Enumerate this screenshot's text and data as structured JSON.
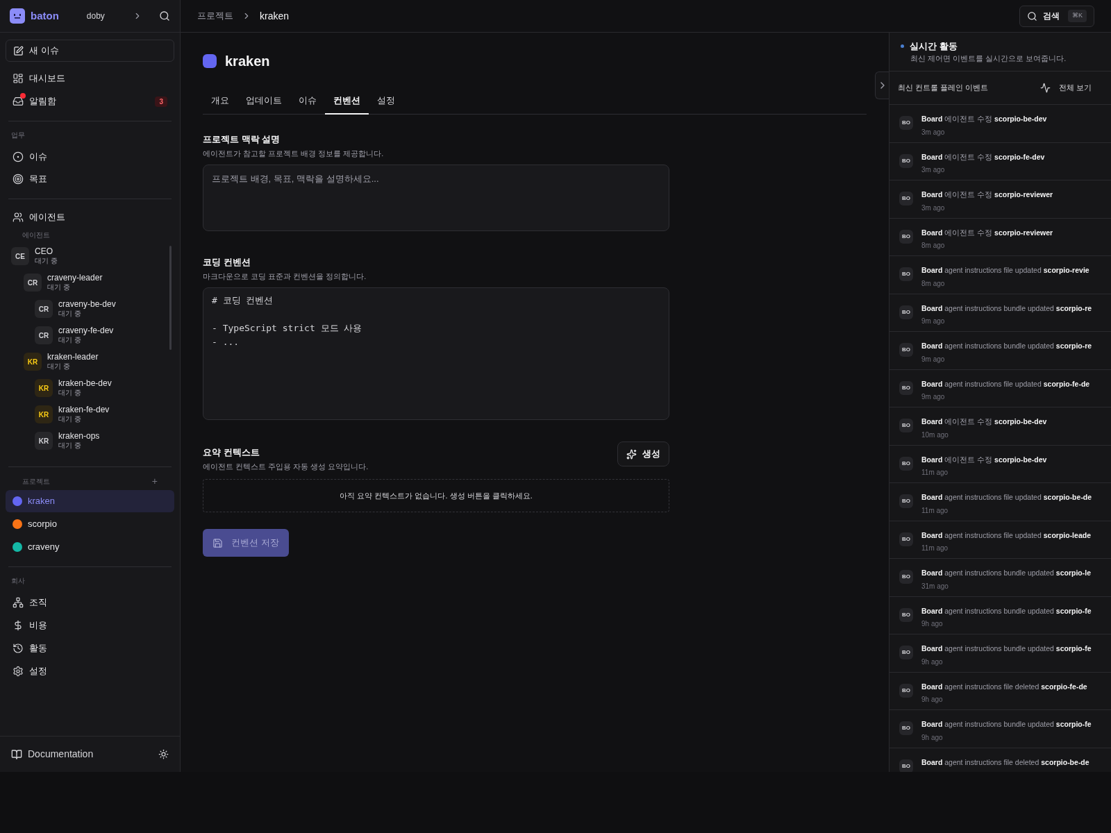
{
  "sidebar": {
    "brand": "baton",
    "workspace": "doby",
    "new_issue": "새 이슈",
    "top_items": [
      {
        "label": "대시보드"
      },
      {
        "label": "알림함",
        "badge": "3",
        "unread": true
      }
    ],
    "sections": [
      {
        "title": "업무",
        "items": [
          {
            "label": "이슈"
          },
          {
            "label": "목표"
          }
        ]
      }
    ],
    "agents": {
      "label": "에이전트",
      "heading": "에이전트",
      "tree": [
        {
          "initials": "CE",
          "name": "CEO",
          "status": "대기 중",
          "color": "#d4d4d8",
          "children": [
            {
              "initials": "CR",
              "name": "craveny-leader",
              "status": "대기 중",
              "color": "#d4d4d8",
              "children": [
                {
                  "initials": "CR",
                  "name": "craveny-be-dev",
                  "status": "대기 중",
                  "color": "#d4d4d8"
                },
                {
                  "initials": "CR",
                  "name": "craveny-fe-dev",
                  "status": "대기 중",
                  "color": "#d4d4d8"
                }
              ]
            },
            {
              "initials": "KR",
              "name": "kraken-leader",
              "status": "대기 중",
              "color": "#facc15",
              "children": [
                {
                  "initials": "KR",
                  "name": "kraken-be-dev",
                  "status": "대기 중",
                  "color": "#facc15"
                },
                {
                  "initials": "KR",
                  "name": "kraken-fe-dev",
                  "status": "대기 중",
                  "color": "#facc15"
                },
                {
                  "initials": "KR",
                  "name": "kraken-ops",
                  "status": "대기 중",
                  "color": "#d4d4d8"
                }
              ]
            }
          ]
        }
      ]
    },
    "projects": {
      "title": "프로젝트",
      "add": "+",
      "items": [
        {
          "name": "kraken",
          "color": "#6366f1",
          "selected": true
        },
        {
          "name": "scorpio",
          "color": "#f97316",
          "selected": false
        },
        {
          "name": "craveny",
          "color": "#14b8a6",
          "selected": false
        }
      ]
    },
    "company": {
      "title": "회사",
      "items": [
        {
          "label": "조직"
        },
        {
          "label": "비용"
        },
        {
          "label": "활동"
        },
        {
          "label": "설정"
        }
      ]
    },
    "docs": "Documentation"
  },
  "breadcrumb": [
    "프로젝트",
    "kraken"
  ],
  "search": {
    "label": "검색",
    "shortcut": "⌘K"
  },
  "project": {
    "name": "kraken",
    "color": "#6366f1"
  },
  "tabs": [
    {
      "label": "개요",
      "selected": false
    },
    {
      "label": "업데이트",
      "selected": false
    },
    {
      "label": "이슈",
      "selected": false
    },
    {
      "label": "컨벤션",
      "selected": true
    },
    {
      "label": "설정",
      "selected": false
    }
  ],
  "context": {
    "title": "프로젝트 맥락 설명",
    "description": "에이전트가 참고할 프로젝트 배경 정보를 제공합니다.",
    "placeholder": "프로젝트 배경, 목표, 맥락을 설명하세요..."
  },
  "conventions": {
    "title": "코딩 컨벤션",
    "description": "마크다운으로 코딩 표준과 컨벤션을 정의합니다.",
    "value": "# 코딩 컨벤션\n\n- TypeScript strict 모드 사용\n- ..."
  },
  "summary": {
    "title": "요약 컨텍스트",
    "description": "에이전트 컨텍스트 주입용 자동 생성 요약입니다.",
    "generate": "생성",
    "empty": "아직 요약 컨텍스트가 없습니다. 생성 버튼을 클릭하세요."
  },
  "save": {
    "label": "컨벤션 저장",
    "disabled": true
  },
  "activity": {
    "title": "실시간 활동",
    "subtitle": "최신 제어면 이벤트를 실시간으로 보여줍니다.",
    "list_title": "최신 컨트롤 플레인 이벤트",
    "view_all": "전체 보기",
    "events": [
      {
        "avatar": "BO",
        "actor": "Board",
        "action": "에이전트 수정",
        "target": "scorpio-be-dev",
        "time": "3m ago"
      },
      {
        "avatar": "BO",
        "actor": "Board",
        "action": "에이전트 수정",
        "target": "scorpio-fe-dev",
        "time": "3m ago"
      },
      {
        "avatar": "BO",
        "actor": "Board",
        "action": "에이전트 수정",
        "target": "scorpio-reviewer",
        "time": "3m ago"
      },
      {
        "avatar": "BO",
        "actor": "Board",
        "action": "에이전트 수정",
        "target": "scorpio-reviewer",
        "time": "8m ago"
      },
      {
        "avatar": "BO",
        "actor": "Board",
        "action": "agent instructions file updated",
        "target": "scorpio-revie",
        "time": "8m ago"
      },
      {
        "avatar": "BO",
        "actor": "Board",
        "action": "agent instructions bundle updated",
        "target": "scorpio-re",
        "time": "9m ago"
      },
      {
        "avatar": "BO",
        "actor": "Board",
        "action": "agent instructions bundle updated",
        "target": "scorpio-re",
        "time": "9m ago"
      },
      {
        "avatar": "BO",
        "actor": "Board",
        "action": "agent instructions file updated",
        "target": "scorpio-fe-de",
        "time": "9m ago"
      },
      {
        "avatar": "BO",
        "actor": "Board",
        "action": "에이전트 수정",
        "target": "scorpio-be-dev",
        "time": "10m ago"
      },
      {
        "avatar": "BO",
        "actor": "Board",
        "action": "에이전트 수정",
        "target": "scorpio-be-dev",
        "time": "11m ago"
      },
      {
        "avatar": "BO",
        "actor": "Board",
        "action": "agent instructions file updated",
        "target": "scorpio-be-de",
        "time": "11m ago"
      },
      {
        "avatar": "BO",
        "actor": "Board",
        "action": "agent instructions file updated",
        "target": "scorpio-leade",
        "time": "11m ago"
      },
      {
        "avatar": "BO",
        "actor": "Board",
        "action": "agent instructions bundle updated",
        "target": "scorpio-le",
        "time": "31m ago"
      },
      {
        "avatar": "BO",
        "actor": "Board",
        "action": "agent instructions bundle updated",
        "target": "scorpio-fe",
        "time": "9h ago"
      },
      {
        "avatar": "BO",
        "actor": "Board",
        "action": "agent instructions bundle updated",
        "target": "scorpio-fe",
        "time": "9h ago"
      },
      {
        "avatar": "BO",
        "actor": "Board",
        "action": "agent instructions file deleted",
        "target": "scorpio-fe-de",
        "time": "9h ago"
      },
      {
        "avatar": "BO",
        "actor": "Board",
        "action": "agent instructions bundle updated",
        "target": "scorpio-fe",
        "time": "9h ago"
      },
      {
        "avatar": "BO",
        "actor": "Board",
        "action": "agent instructions file deleted",
        "target": "scorpio-be-de"
      }
    ]
  }
}
